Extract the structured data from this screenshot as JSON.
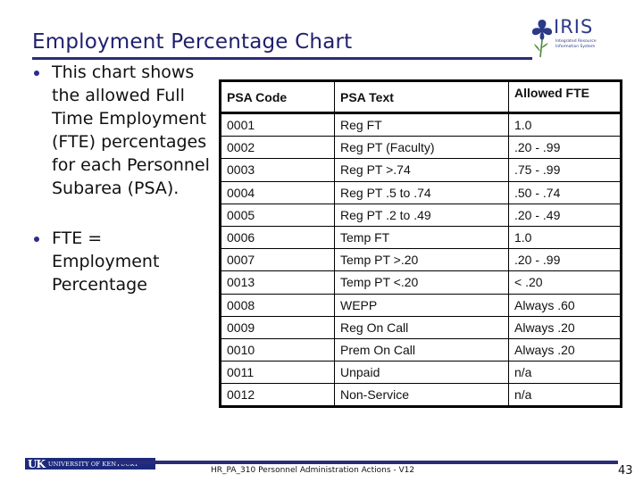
{
  "slide": {
    "title": "Employment Percentage Chart",
    "logo": {
      "name": "IRIS",
      "subtitle": "Integrated Resource Information System"
    },
    "bullets": [
      "This chart shows the allowed Full Time Employment (FTE) percentages for each Personnel Subarea (PSA).",
      "FTE = Employment Percentage"
    ],
    "table": {
      "headers": [
        "PSA Code",
        "PSA Text",
        "Allowed FTE"
      ],
      "rows": [
        [
          "0001",
          "Reg FT",
          "1.0"
        ],
        [
          "0002",
          "Reg PT (Faculty)",
          ".20 - .99"
        ],
        [
          "0003",
          "Reg PT >.74",
          ".75 - .99"
        ],
        [
          "0004",
          "Reg PT .5 to .74",
          ".50 - .74"
        ],
        [
          "0005",
          "Reg PT .2 to .49",
          ".20 - .49"
        ],
        [
          "0006",
          "Temp FT",
          "1.0"
        ],
        [
          "0007",
          "Temp PT >.20",
          ".20 - .99"
        ],
        [
          "0013",
          "Temp PT <.20",
          " < .20"
        ],
        [
          "0008",
          "WEPP",
          "Always .60"
        ],
        [
          "0009",
          "Reg On Call",
          "Always .20"
        ],
        [
          "0010",
          "Prem On Call",
          "Always .20"
        ],
        [
          "0011",
          "Unpaid",
          "n/a"
        ],
        [
          "0012",
          "Non-Service",
          "n/a"
        ]
      ]
    },
    "footer": {
      "university_mark": "UK",
      "university_name": "UNIVERSITY OF KENTUCKY",
      "course": "HR_PA_310 Personnel Administration Actions - V12",
      "page_number": "43"
    },
    "colors": {
      "title": "#1f1f6e",
      "rule": "#2b2b7a",
      "brand": "#1d2a7c"
    }
  }
}
